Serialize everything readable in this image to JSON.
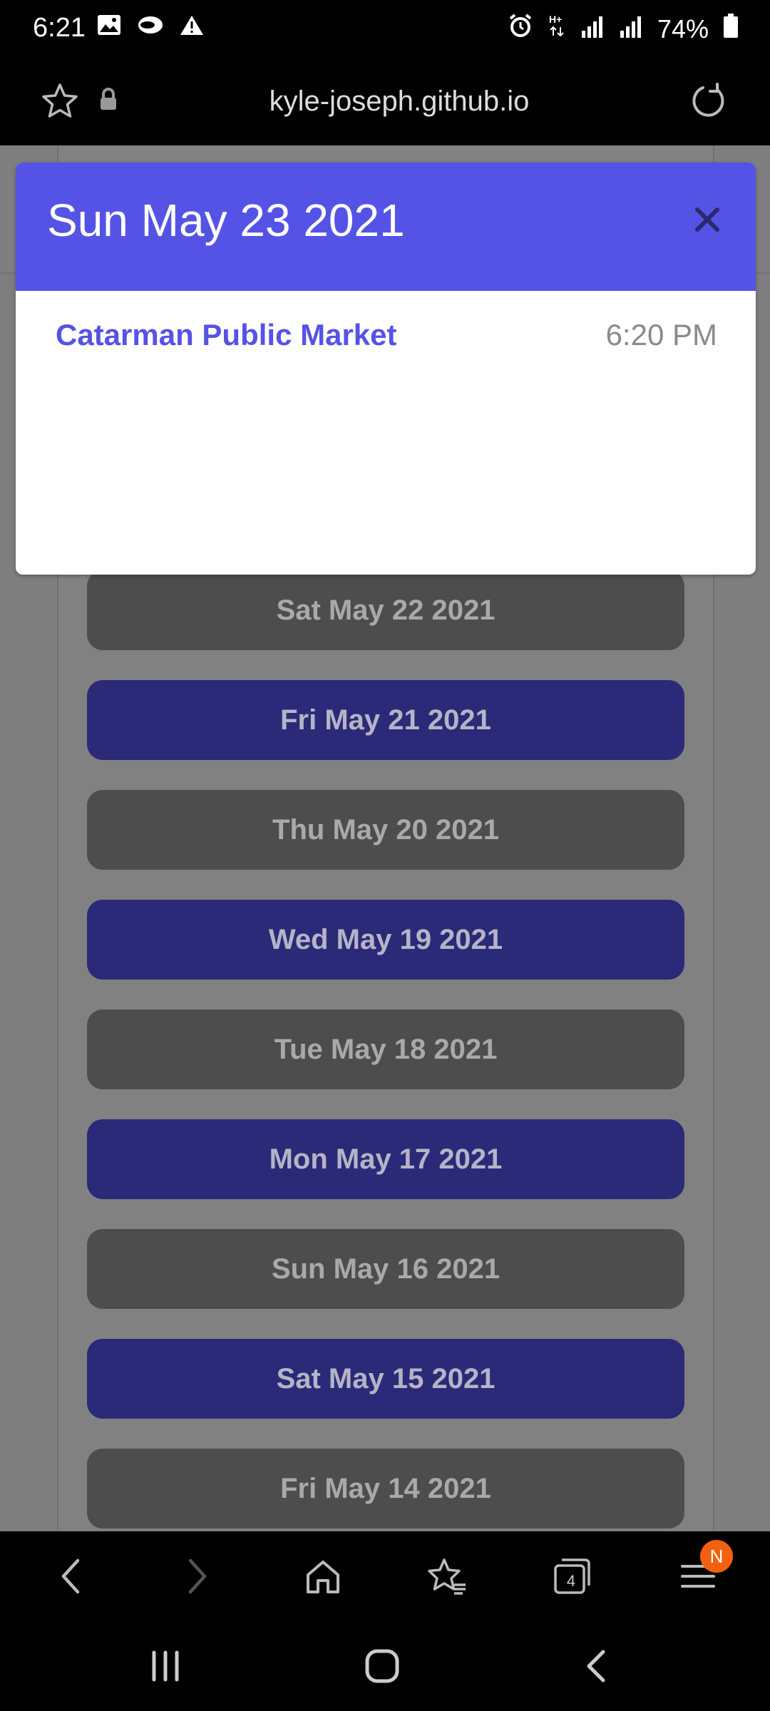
{
  "status_bar": {
    "time": "6:21",
    "battery": "74%",
    "left_icons": [
      "image-icon",
      "cloud-icon",
      "warning-icon"
    ],
    "right_icons": [
      "alarm-icon",
      "hplus-data-icon",
      "signal-icon",
      "signal-icon",
      "battery-icon"
    ]
  },
  "browser": {
    "url": "kyle-joseph.github.io",
    "tab_count": "4",
    "menu_badge": "N"
  },
  "modal": {
    "title": "Sun May 23 2021",
    "events": [
      {
        "name": "Catarman Public Market",
        "time": "6:20 PM"
      }
    ]
  },
  "date_list": [
    {
      "label": "Sat May 22 2021",
      "style": "grey"
    },
    {
      "label": "Fri May 21 2021",
      "style": "blue"
    },
    {
      "label": "Thu May 20 2021",
      "style": "grey"
    },
    {
      "label": "Wed May 19 2021",
      "style": "blue"
    },
    {
      "label": "Tue May 18 2021",
      "style": "grey"
    },
    {
      "label": "Mon May 17 2021",
      "style": "blue"
    },
    {
      "label": "Sun May 16 2021",
      "style": "grey"
    },
    {
      "label": "Sat May 15 2021",
      "style": "blue"
    },
    {
      "label": "Fri May 14 2021",
      "style": "grey"
    }
  ],
  "colors": {
    "modal_header": "#5553e6",
    "event_link": "#5553e6",
    "date_blue": "#2b2a78",
    "date_grey": "#4d4d4d",
    "badge": "#f3600f"
  }
}
